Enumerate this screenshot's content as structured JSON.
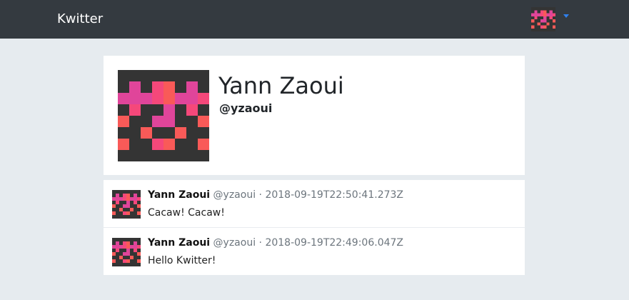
{
  "navbar": {
    "brand": "Kwitter",
    "user_menu": {
      "avatar_icon": "identicon-avatar"
    }
  },
  "profile": {
    "name": "Yann Zaoui",
    "handle": "@yzaoui",
    "avatar_icon": "identicon-avatar"
  },
  "feed": {
    "kweets": [
      {
        "author": "Yann Zaoui",
        "handle": "@yzaoui",
        "separator": "·",
        "timestamp": "2018-09-19T22:50:41.273Z",
        "text": "Cacaw! Cacaw!"
      },
      {
        "author": "Yann Zaoui",
        "handle": "@yzaoui",
        "separator": "·",
        "timestamp": "2018-09-19T22:49:06.047Z",
        "text": "Hello Kwitter!"
      }
    ]
  },
  "colors": {
    "navbar_bg": "#343a40",
    "page_bg": "#e6ebef",
    "avatar_bg": "#343434",
    "avatar_pink": "#f5487a",
    "avatar_magenta": "#e0459a",
    "avatar_coral": "#f95a58",
    "caret": "#2f80ed",
    "muted_text": "#6c757d"
  }
}
